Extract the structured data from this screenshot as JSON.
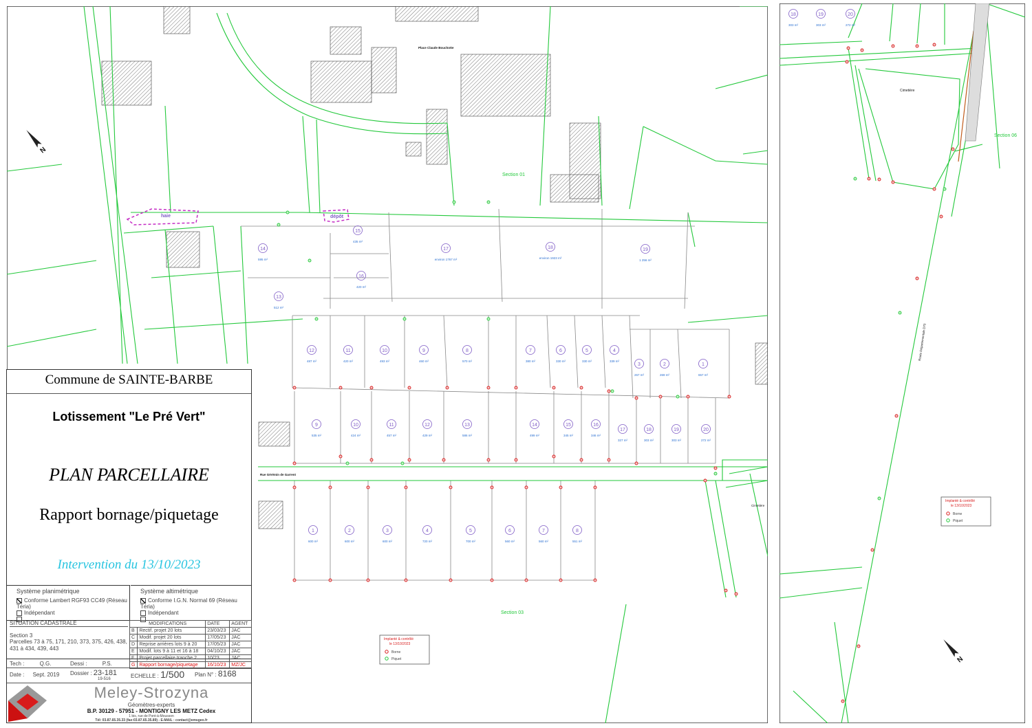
{
  "cartouche": {
    "commune": "Commune de SAINTE-BARBE",
    "lotissement": "Lotissement \"Le Pré Vert\"",
    "plan_title": "PLAN PARCELLAIRE",
    "subtitle": "Rapport bornage/piquetage",
    "intervention": "Intervention du 13/10/2023",
    "sys_plani_title": "Système planimétrique",
    "sys_plani_opts": [
      "Conforme Lambert RGF93 CC49 (Réseau Téria)",
      "Indépendant",
      "........."
    ],
    "sys_alti_title": "Système altimétrique",
    "sys_alti_opts": [
      "Conforme I.G.N. Normal 69 (Réseau Téria)",
      "Indépendant",
      "........."
    ],
    "situation_label": "SITUATION CADASTRALE",
    "section": "Section 3",
    "parcelles": "Parcelles 73 à 75, 171, 210, 373, 375, 426, 438, 431 à 434, 439, 443",
    "mods_label": "MODIFICATIONS",
    "date_label": "DATE",
    "agent_label": "AGENT",
    "mods": [
      {
        "l": "B",
        "t": "Rectif. projet 20 lots",
        "d": "23/03/23",
        "a": "JAC"
      },
      {
        "l": "C",
        "t": "Modif. projet 20 lots",
        "d": "17/05/23",
        "a": "JAC"
      },
      {
        "l": "D",
        "t": "Reprise arrières lots 9 à 20",
        "d": "17/05/23",
        "a": "JAC"
      },
      {
        "l": "E",
        "t": "Modif. lots 9 à 11 et 16 à 18",
        "d": "04/10/23",
        "a": "JAC"
      },
      {
        "l": "F",
        "t": "Projet parcellaire tranche 2",
        "d": "10/23",
        "a": "JAC"
      },
      {
        "l": "G",
        "t": "Rapport bornage/piquetage",
        "d": "16/10/23",
        "a": "MZ/JC"
      }
    ],
    "tech_label": "Tech :",
    "tech": "Q.G.",
    "dessi_label": "Dessi :",
    "dessi": "P.S.",
    "date_lbl": "Date :",
    "date": "Sept. 2019",
    "dossier_label": "Dossier :",
    "dossier": "23-181",
    "dossier2": "19-516",
    "echelle_label": "ECHELLE :",
    "echelle": "1/500",
    "plan_no_label": "Plan N° :",
    "plan_no": "8168",
    "firm": "Meley-Strozyna",
    "firm_sub": "Géomètres-experts",
    "firm_addr": "B.P. 30129 - 57951 - MONTIGNY LES METZ Cedex",
    "firm_addr2": "1 bis, rue de Pont-à-Mousson",
    "firm_contact": "Tél: 03.87.65.35.33 (fax:03.87.65.35.89) - E-MAIL : contact@emsgeo.fr"
  },
  "legend": {
    "title": "Implanté & contrôlé",
    "date": "le 13/10/2023",
    "items": [
      "Borne",
      "Piquet"
    ]
  },
  "map_labels": {
    "section01": "Section 01",
    "section03": "Section 03",
    "section06": "Section 06",
    "haie": "haie",
    "depot": "dépôt",
    "rue": "Rue Gérémin de Garrent",
    "place": "Place Claude Bouchotte",
    "cimetiere": "Cimetière",
    "route": "Route Départementale D70"
  },
  "lots_top": [
    {
      "n": "15",
      "a": "435 m²"
    },
    {
      "n": "16",
      "a": "420 m²"
    },
    {
      "n": "17",
      "a": "environ 1767 m²"
    },
    {
      "n": "18",
      "a": "environ 1923 m²"
    },
    {
      "n": "19",
      "a": "1 256 m²"
    },
    {
      "n": "14",
      "a": "595 m²"
    },
    {
      "n": "13",
      "a": "512 m²"
    }
  ],
  "lots_row1": [
    {
      "n": "12",
      "a": "487 m²"
    },
    {
      "n": "11",
      "a": "420 m²"
    },
    {
      "n": "10",
      "a": "493 m²"
    },
    {
      "n": "9",
      "a": "460 m²"
    },
    {
      "n": "8",
      "a": "570 m²"
    },
    {
      "n": "7",
      "a": "380 m²"
    },
    {
      "n": "6",
      "a": "330 m²"
    },
    {
      "n": "5",
      "a": "330 m²"
    },
    {
      "n": "4",
      "a": "339 m²"
    },
    {
      "n": "3",
      "a": "267 m²"
    },
    {
      "n": "2",
      "a": "269 m²"
    },
    {
      "n": "1",
      "a": "657 m²"
    }
  ],
  "lots_row2": [
    {
      "n": "9",
      "a": "535 m²"
    },
    {
      "n": "10",
      "a": "424 m²"
    },
    {
      "n": "11",
      "a": "457 m²"
    },
    {
      "n": "12",
      "a": "429 m²"
    },
    {
      "n": "13",
      "a": "586 m²"
    },
    {
      "n": "14",
      "a": "499 m²"
    },
    {
      "n": "15",
      "a": "345 m²"
    },
    {
      "n": "16",
      "a": "346 m²"
    },
    {
      "n": "17",
      "a": "327 m²"
    },
    {
      "n": "18",
      "a": "303 m²"
    },
    {
      "n": "19",
      "a": "303 m²"
    },
    {
      "n": "20",
      "a": "272 m²"
    }
  ],
  "lots_row3": [
    {
      "n": "1",
      "a": "600 m²"
    },
    {
      "n": "2",
      "a": "600 m²"
    },
    {
      "n": "3",
      "a": "600 m²"
    },
    {
      "n": "4",
      "a": "720 m²"
    },
    {
      "n": "5",
      "a": "700 m²"
    },
    {
      "n": "6",
      "a": "560 m²"
    },
    {
      "n": "7",
      "a": "560 m²"
    },
    {
      "n": "8",
      "a": "551 m²"
    }
  ],
  "lots_side": [
    {
      "n": "18",
      "a": "303 m²"
    },
    {
      "n": "19",
      "a": "303 m²"
    },
    {
      "n": "20",
      "a": "272 m²"
    }
  ],
  "colors": {
    "green": "#22c83a",
    "red": "#d81b1b",
    "blue": "#2a6fd1",
    "purple": "#7f5cc6",
    "magenta": "#c42bc4",
    "cyan": "#27c4e0"
  }
}
